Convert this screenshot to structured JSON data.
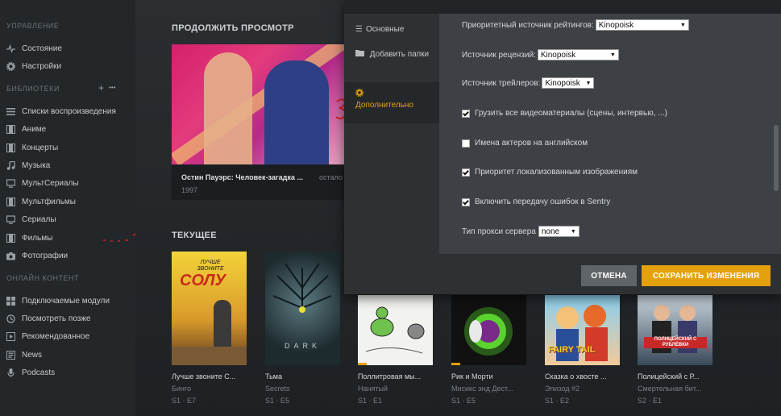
{
  "sidebar": {
    "manage_header": "УПРАВЛЕНИЕ",
    "manage_items": [
      {
        "label": "Состояние",
        "icon": "pulse-icon"
      },
      {
        "label": "Настройки",
        "icon": "gear-icon"
      }
    ],
    "libraries_header": "БИБЛИОТЕКИ",
    "libraries_add": "+",
    "libraries_more": "•••",
    "library_items": [
      {
        "label": "Списки воспроизведения",
        "icon": "list-icon"
      },
      {
        "label": "Аниме",
        "icon": "film-icon"
      },
      {
        "label": "Концерты",
        "icon": "film-icon"
      },
      {
        "label": "Музыка",
        "icon": "music-icon"
      },
      {
        "label": "МультСериалы",
        "icon": "tv-icon"
      },
      {
        "label": "Мультфильмы",
        "icon": "film-icon"
      },
      {
        "label": "Сериалы",
        "icon": "tv-icon"
      },
      {
        "label": "Фильмы",
        "icon": "film-icon"
      },
      {
        "label": "Фотографии",
        "icon": "camera-icon"
      }
    ],
    "online_header": "ОНЛАЙН КОНТЕНТ",
    "online_items": [
      {
        "label": "Подключаемые модули",
        "icon": "grid-icon"
      },
      {
        "label": "Посмотреть позже",
        "icon": "clock-icon"
      },
      {
        "label": "Рекомендованное",
        "icon": "play-icon"
      },
      {
        "label": "News",
        "icon": "news-icon"
      },
      {
        "label": "Podcasts",
        "icon": "mic-icon"
      }
    ]
  },
  "main": {
    "continue_title": "ПРОДОЛЖИТЬ ПРОСМОТР",
    "hero": {
      "title": "Остин Пауэрс: Человек-загадка ...",
      "extra": "остало",
      "year": "1997"
    },
    "current_title": "ТЕКУЩЕЕ",
    "cards": [
      {
        "title": "Лучше звоните С...",
        "subtitle": "Бинго",
        "episode": "S1 · E7",
        "progress": 0
      },
      {
        "title": "Тьма",
        "subtitle": "Secrets",
        "episode": "S1 · E5",
        "progress": 0
      },
      {
        "title": "Поллитровая мы...",
        "subtitle": "Нанятый",
        "episode": "S1 · E1",
        "progress": 0.12
      },
      {
        "title": "Рик и Морти",
        "subtitle": "Мисикс энд Дест...",
        "episode": "S1 · E5",
        "progress": 0.12
      },
      {
        "title": "Сказка о хвосте ...",
        "subtitle": "Эпизод #2",
        "episode": "S1 · E2",
        "progress": 0
      },
      {
        "title": "Полицейский с Р...",
        "subtitle": "Смертельная бит...",
        "episode": "S2 · E1",
        "progress": 0
      }
    ],
    "poster_texts": {
      "bcs_line": "ЛУЧШЕ ЗВОНИТЕ",
      "bcs_name": "СОЛУ",
      "dark": "DARK",
      "fairy": "FAIRY TAIL",
      "rublevka": "ПОЛИЦЕЙСКИЙ С РУБЛЁВКИ"
    }
  },
  "dialog": {
    "tabs": [
      {
        "label": "Основные",
        "icon": "sliders-icon"
      },
      {
        "label": "Добавить папки",
        "icon": "folder-icon"
      },
      {
        "label": "Дополнительно",
        "icon": "gear-icon"
      }
    ],
    "settings": {
      "rating_label": "Приоритетный источник рейтингов:",
      "rating_value": "Kinopoisk",
      "reviews_label": "Источник рецензий:",
      "reviews_value": "Kinopoisk",
      "trailers_label": "Источник трейлеров:",
      "trailers_value": "Kinopoisk",
      "cb_video": "Грузить все видеоматериалы (сцены, интервью, ...)",
      "cb_actors": "Имена актеров на английском",
      "cb_localized": "Приоритет локализованным изображениям",
      "cb_sentry": "Включить передачу ошибок в Sentry",
      "proxy_label": "Тип прокси сервера",
      "proxy_value": "none"
    },
    "cancel_label": "ОТМЕНА",
    "save_label": "СОХРАНИТЬ ИЗМЕНЕНИЯ"
  },
  "colors": {
    "accent": "#e5a00d",
    "annotation": "#d81b1b"
  }
}
